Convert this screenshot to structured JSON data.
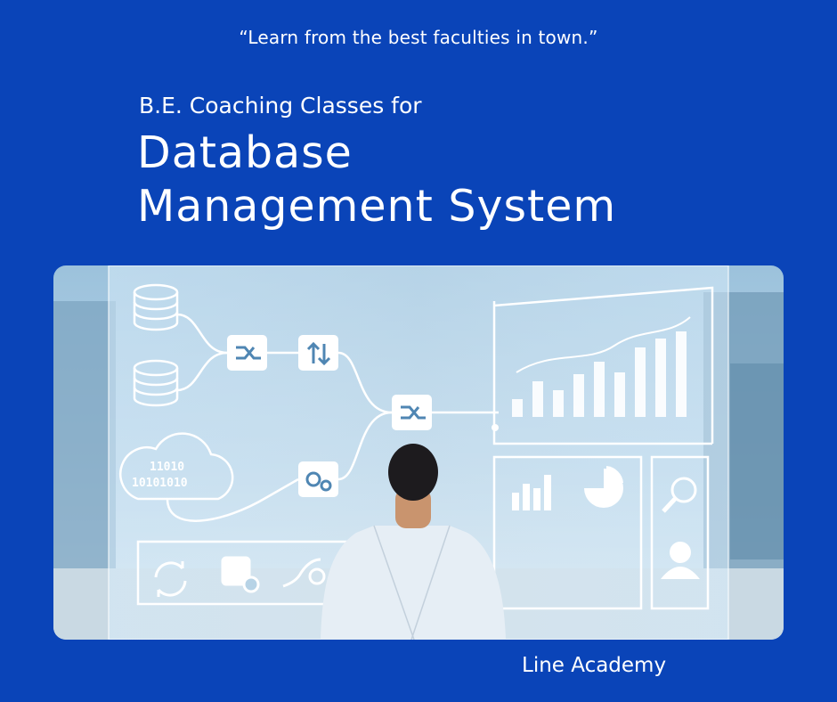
{
  "tagline": "“Learn from the best faculties in town.”",
  "subtitle": "B.E. Coaching Classes for",
  "title": {
    "line1": "Database",
    "line2": "Management System"
  },
  "hero_image": {
    "cloud_text_line1": "11010",
    "cloud_text_line2": "10101010"
  },
  "brand": "Line Academy",
  "colors": {
    "background": "#0a44b8",
    "text": "#ffffff",
    "screen_tint": "#cfe6f7"
  }
}
